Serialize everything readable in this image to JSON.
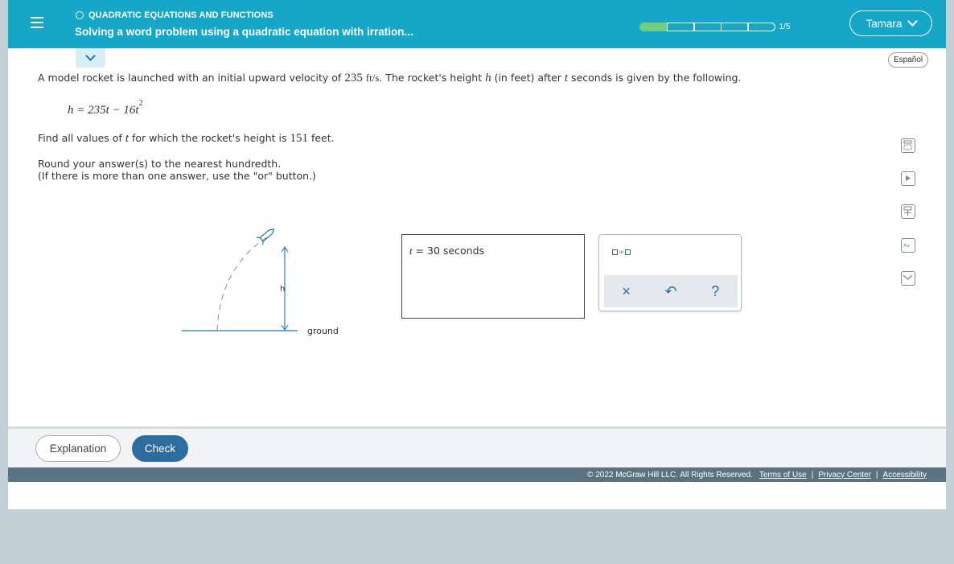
{
  "header": {
    "topic": "QUADRATIC EQUATIONS AND FUNCTIONS",
    "title": "Solving a word problem using a quadratic equation with irration...",
    "progress_label": "1/5",
    "progress_done": 1,
    "progress_total": 5,
    "user_name": "Tamara"
  },
  "language_button": "Español",
  "problem": {
    "line1_a": "A model rocket is launched with an initial upward velocity of ",
    "velocity": "235",
    "velocity_unit": "ft/s",
    "line1_b": ". The rocket's height ",
    "var_h": "h",
    "line1_c": " (in feet) after ",
    "var_t": "t",
    "line1_d": " seconds is given by the following.",
    "equation_lhs": "h = 235t − 16t",
    "equation_exp": "2",
    "find_a": "Find all values of ",
    "find_var": "t",
    "find_b": " for which the rocket's height is ",
    "height": "151",
    "find_c": " feet.",
    "round_line1": "Round your answer(s) to the nearest hundredth.",
    "round_line2": "(If there is more than one answer, use the \"or\" button.)"
  },
  "diagram": {
    "h_label": "h",
    "ground_label": "ground"
  },
  "answer": {
    "var": "t",
    "equals": " = ",
    "value": "30 seconds"
  },
  "keypad": {
    "or_label": "or",
    "clear_symbol": "×",
    "undo_symbol": "↶",
    "help_symbol": "?"
  },
  "tools": [
    "calculator-icon",
    "video-icon",
    "calculator-alt-icon",
    "dictionary-icon",
    "message-icon"
  ],
  "buttons": {
    "explanation": "Explanation",
    "check": "Check"
  },
  "footer": {
    "copyright": "© 2022 McGraw Hill LLC. All Rights Reserved.",
    "terms": "Terms of Use",
    "privacy": "Privacy Center",
    "accessibility": "Accessibility"
  },
  "colors": {
    "header_bg": "#15a6c8",
    "progress_done": "#6fcf7a",
    "primary_button": "#2d6c9e",
    "footer_bg": "#5a7380"
  }
}
